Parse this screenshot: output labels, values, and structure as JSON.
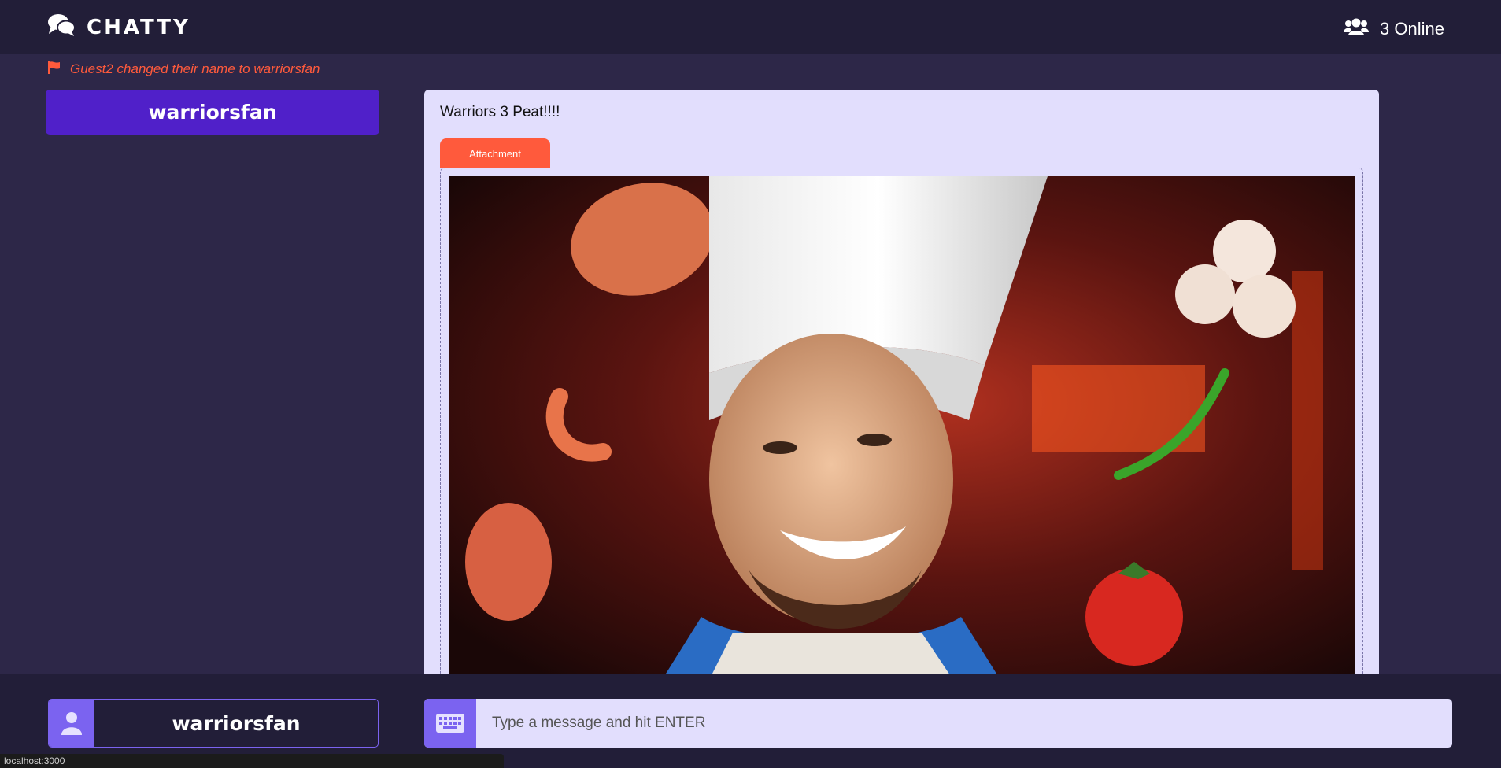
{
  "header": {
    "brand": "CHATTY",
    "online_count": "3 Online"
  },
  "notification": {
    "text": "Guest2 changed their name to warriorsfan"
  },
  "sidebar": {
    "users": [
      {
        "name": "warriorsfan"
      }
    ]
  },
  "messages": [
    {
      "text": "Warriors 3 Peat!!!!",
      "attachment_label": "Attachment"
    }
  ],
  "composer": {
    "username": "warriorsfan",
    "placeholder": "Type a message and hit ENTER"
  },
  "status_bar": {
    "url": "localhost:3000"
  },
  "colors": {
    "header_bg": "#221e38",
    "page_bg": "#2d2748",
    "accent_purple": "#5020c9",
    "icon_purple": "#7b63f0",
    "accent_orange": "#ff5a3c",
    "panel_bg": "#e2defd"
  }
}
